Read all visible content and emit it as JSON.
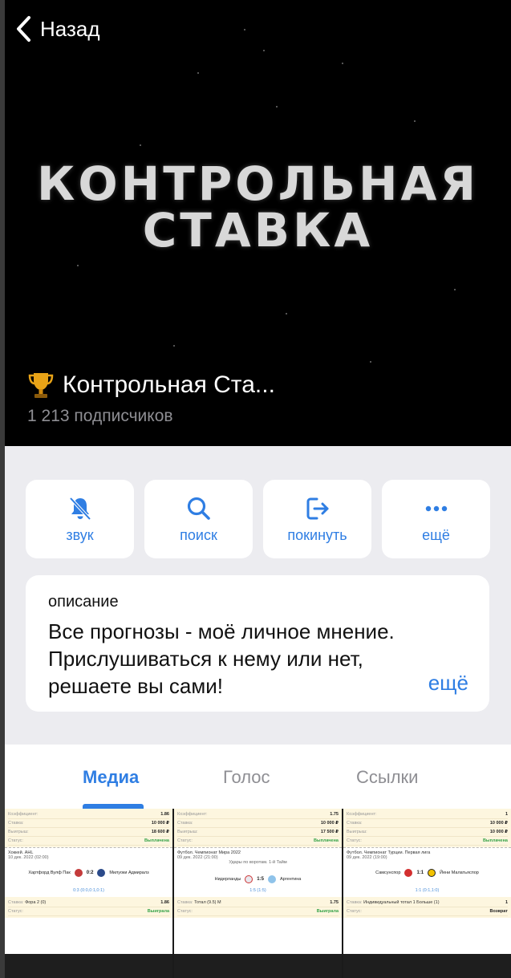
{
  "header": {
    "back_label": "Назад",
    "logo_line1": "КОНТРОЛЬНАЯ",
    "logo_line2": "СТАВКА",
    "channel_name": "Контрольная Ста...",
    "subscribers": "1 213 подписчиков"
  },
  "actions": [
    {
      "label": "звук",
      "icon": "bell-slash-icon"
    },
    {
      "label": "поиск",
      "icon": "search-icon"
    },
    {
      "label": "покинуть",
      "icon": "leave-icon"
    },
    {
      "label": "ещё",
      "icon": "more-icon"
    }
  ],
  "description": {
    "label": "описание",
    "text": "Все прогнозы - моё личное мнение. Прислушиваться к нему или нет, решаете вы сами!",
    "more": "ещё"
  },
  "tabs": [
    "Медиа",
    "Голос",
    "Ссылки"
  ],
  "media": [
    {
      "rows": [
        [
          "Коэффициент:",
          "1.86"
        ],
        [
          "Ставка:",
          "10 000 ₽"
        ],
        [
          "Выигрыш:",
          "18 600 ₽"
        ],
        [
          "Статус:",
          "Выплачена"
        ]
      ],
      "event_title": "Хоккей. AHL",
      "event_date": "10 дек. 2022 (02:00)",
      "team1": "Хартфорд Вулф Пак",
      "score": "0:2",
      "team2": "Милуоки Адмиралз",
      "sub": "0:3 (0:0,0:1,0:1)",
      "bet_label": "Ставка:",
      "bet": "Фора 2 (0)",
      "bet_coef": "1.86",
      "status_label": "Статус:",
      "status": "Выиграла"
    },
    {
      "rows": [
        [
          "Коэффициент:",
          "1.75"
        ],
        [
          "Ставка:",
          "10 000 ₽"
        ],
        [
          "Выигрыш:",
          "17 500 ₽"
        ],
        [
          "Статус:",
          "Выплачена"
        ]
      ],
      "event_title": "Футбол. Чемпионат Мира 2022",
      "event_date": "09 дек. 2022 (21:00)",
      "extra": "Удары по воротам. 1-й Тайм",
      "team1": "Нидерланды",
      "score": "1:5",
      "team2": "Аргентина",
      "sub": "1:5 (1:5)",
      "bet_label": "Ставка:",
      "bet": "Тотал (9.5) М",
      "bet_coef": "1.75",
      "status_label": "Статус:",
      "status": "Выиграла"
    },
    {
      "rows": [
        [
          "Коэффициент:",
          "1"
        ],
        [
          "Ставка:",
          "10 000 ₽"
        ],
        [
          "Выигрыш:",
          "10 000 ₽"
        ],
        [
          "Статус:",
          "Выплачена"
        ]
      ],
      "event_title": "Футбол. Чемпионат Турции. Первая лига",
      "event_date": "09 дек. 2022 (19:00)",
      "team1": "Самсунспор",
      "score": "1:1",
      "team2": "Йени Малатьяспор",
      "sub": "1:1 (0:1,1:0)",
      "bet_label": "Ставка:",
      "bet": "Индивидуальный тотал 1 Больше (1)",
      "bet_coef": "1",
      "status_label": "Статус:",
      "status": "Возврат"
    }
  ],
  "colors": {
    "accent": "#2f7ee3",
    "header_bg": "#000000",
    "page_bg": "#ececf0",
    "win_green": "#37a349"
  }
}
